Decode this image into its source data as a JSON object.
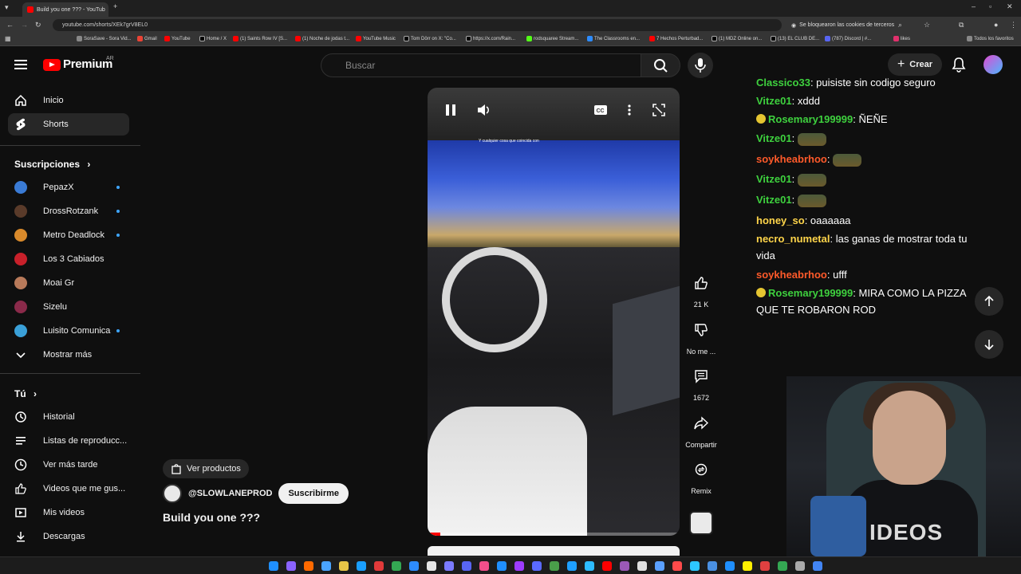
{
  "browser": {
    "tab_title": "Build you one ??? - YouTub",
    "url": "youtube.com/shorts/XEk7grV8EL0",
    "cookie_notice": "Se bloquearon las cookies de terceros",
    "bookmarks": [
      "SoraSave - Sora Vid...",
      "Gmail",
      "YouTube",
      "Home / X",
      "(1) Saints Row IV [S...",
      "(1) Noche de jodas t...",
      "YouTube Music",
      "Tom Dörr on X: \"Co...",
      "https://x.com/Rain...",
      "rodsquaree Stream...",
      "The Classrooms en...",
      "7 Hechos Perturbad...",
      "(1) MDZ Online on...",
      "(13) EL CLUB DE...",
      "(787) Discord | #...",
      "likes"
    ],
    "all_bookmarks": "Todos los favoritos"
  },
  "header": {
    "logo": "Premium",
    "region": "AR",
    "search_placeholder": "Buscar",
    "create_label": "Crear"
  },
  "sidebar": {
    "main": [
      {
        "label": "Inicio",
        "icon": "home-icon"
      },
      {
        "label": "Shorts",
        "icon": "shorts-icon",
        "active": true
      }
    ],
    "subs_heading": "Suscripciones",
    "subscriptions": [
      {
        "label": "PepazX",
        "color": "#3a7bd5",
        "live": true
      },
      {
        "label": "DrossRotzank",
        "color": "#5a3b2a",
        "live": true
      },
      {
        "label": "Metro Deadlock",
        "color": "#d98a2b",
        "live": true
      },
      {
        "label": "Los 3 Cabiados",
        "color": "#c8202a",
        "live": false
      },
      {
        "label": "Moai Gr",
        "color": "#b87a5a",
        "live": false
      },
      {
        "label": "Sizelu",
        "color": "#8a2a4a",
        "live": false
      },
      {
        "label": "Luisito Comunica",
        "color": "#3aa0d8",
        "live": true
      }
    ],
    "more_label": "Mostrar más",
    "you_heading": "Tú",
    "you_items": [
      {
        "label": "Historial",
        "icon": "history-icon"
      },
      {
        "label": "Listas de reproducc...",
        "icon": "playlist-icon"
      },
      {
        "label": "Ver más tarde",
        "icon": "clock-icon"
      },
      {
        "label": "Videos que me gus...",
        "icon": "thumbs-up-icon"
      },
      {
        "label": "Mis videos",
        "icon": "video-icon"
      },
      {
        "label": "Descargas",
        "icon": "download-icon"
      }
    ]
  },
  "short": {
    "caption": "Y cualquier cosa que coincida con",
    "progress": 0.05,
    "products_label": "Ver productos",
    "channel": "@SLOWLANEPROD",
    "subscribe_label": "Suscribirme",
    "title": "Build you one ???",
    "actions": {
      "likes": "21 K",
      "dislike": "No me ...",
      "comments": "1672",
      "share": "Compartir",
      "remix": "Remix"
    }
  },
  "chat": {
    "messages": [
      {
        "user": "Classico33",
        "text": "puisiste sin codigo seguro",
        "color": "#3ed13e"
      },
      {
        "user": "Vitze01",
        "text": "xddd",
        "color": "#3ed13e"
      },
      {
        "user": "Rosemary199999",
        "text": "ÑEÑE",
        "color": "#3ed13e",
        "badge": true
      },
      {
        "user": "Vitze01",
        "text": "",
        "color": "#3ed13e",
        "emote": true
      },
      {
        "user": "soykheabrhoo",
        "text": "",
        "color": "#ff5a2a",
        "emote": true
      },
      {
        "user": "Vitze01",
        "text": "",
        "color": "#3ed13e",
        "emote": true
      },
      {
        "user": "Vitze01",
        "text": "",
        "color": "#3ed13e",
        "emote": true
      },
      {
        "user": "honey_so",
        "text": "oaaaaaa",
        "color": "#ffd54a"
      },
      {
        "user": "necro_numetal",
        "text": "las ganas de mostrar toda tu",
        "color": "#ffd54a"
      },
      {
        "user": "",
        "text": "vida",
        "color": ""
      },
      {
        "user": "soykheabrhoo",
        "text": "ufff",
        "color": "#ff5a2a"
      },
      {
        "user": "Rosemary199999",
        "text": "MIRA COMO LA PIZZA",
        "color": "#3ed13e",
        "badge": true
      },
      {
        "user": "",
        "text": "QUE TE ROBARON ROD",
        "color": ""
      }
    ]
  },
  "webcam": {
    "shirt_text": "IDEOS"
  }
}
